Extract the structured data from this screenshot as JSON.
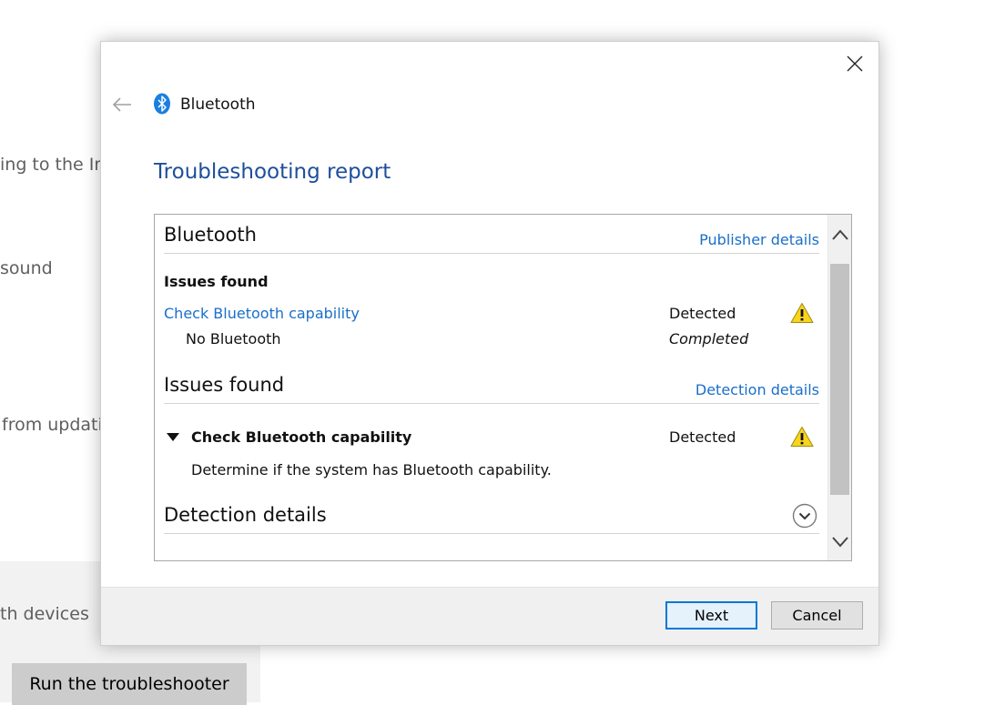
{
  "background": {
    "fragments": [
      "ing to the In",
      "sound",
      "from updati",
      "th devices"
    ],
    "run_button": "Run the troubleshooter"
  },
  "dialog": {
    "header_title": "Bluetooth",
    "page_title": "Troubleshooting report",
    "sections": {
      "bluetooth": {
        "heading": "Bluetooth",
        "link": "Publisher details",
        "issues_label": "Issues found",
        "item_link": "Check Bluetooth capability",
        "item_status": "Detected",
        "sub_item": "No Bluetooth",
        "sub_status": "Completed"
      },
      "issues": {
        "heading": "Issues found",
        "link": "Detection details",
        "item_title": "Check Bluetooth capability",
        "item_status": "Detected",
        "item_desc": "Determine if the system has Bluetooth capability."
      },
      "detection": {
        "heading": "Detection details"
      }
    },
    "buttons": {
      "next": "Next",
      "cancel": "Cancel"
    }
  },
  "icons": {
    "close": "close-icon",
    "back": "back-arrow-icon",
    "bluetooth": "bluetooth-icon",
    "warning": "warning-icon",
    "expand": "chevron-down-icon",
    "scroll_up": "chevron-up-icon",
    "scroll_down": "chevron-down-icon"
  },
  "colors": {
    "accent": "#1a6fc9",
    "title": "#1d4f9b",
    "warning": "#f8d51c",
    "bluetooth": "#1a7fe0"
  }
}
